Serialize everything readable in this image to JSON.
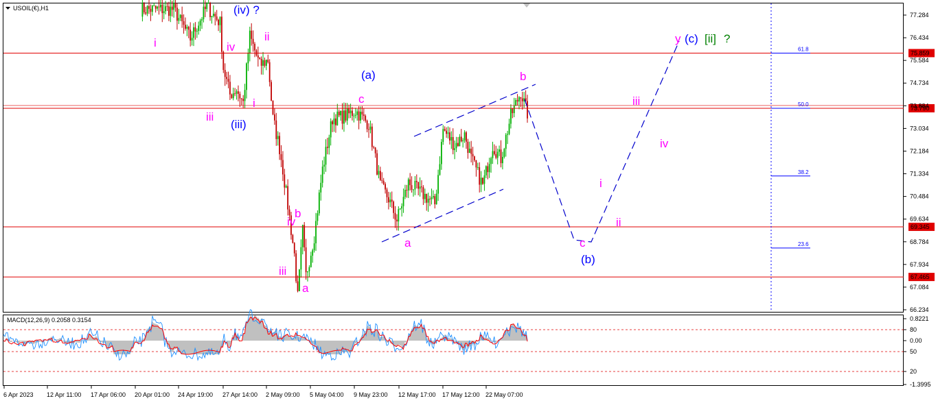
{
  "header": {
    "symbol_label": "USOIL(€),H1"
  },
  "macd": {
    "label": "MACD(12,26,9) 0.2058 0.3154",
    "axis_labels": [
      "0.8221",
      "80",
      "0.00",
      "50",
      "20",
      "-1.3995"
    ]
  },
  "price_axis": {
    "ticks": [
      "77.284",
      "76.434",
      "75.584",
      "74.734",
      "73.884",
      "73.034",
      "72.184",
      "71.334",
      "70.484",
      "69.634",
      "68.784",
      "67.934",
      "67.084",
      "66.234"
    ]
  },
  "price_levels": [
    {
      "label": "75.859",
      "price": 75.859
    },
    {
      "label": "73.790",
      "price": 73.79
    },
    {
      "label": "69.345",
      "price": 69.345
    },
    {
      "label": "67.465",
      "price": 67.465
    }
  ],
  "fib_levels": [
    {
      "label": "61.8",
      "price": 75.859
    },
    {
      "label": "50.0",
      "price": 73.79
    },
    {
      "label": "38.2",
      "price": 71.25
    },
    {
      "label": "23.6",
      "price": 68.55
    }
  ],
  "time_axis": {
    "labels": [
      "6 Apr 2023",
      "12 Apr 11:00",
      "17 Apr 06:00",
      "20 Apr 01:00",
      "24 Apr 19:00",
      "27 Apr 14:00",
      "2 May 09:00",
      "5 May 04:00",
      "9 May 23:00",
      "12 May 17:00",
      "17 May 12:00",
      "22 May 07:00"
    ]
  },
  "wave_labels": [
    {
      "text": "(iv) ?",
      "color": "#0000ff"
    },
    {
      "text": "ii",
      "color": "#ff00ff"
    },
    {
      "text": "iv",
      "color": "#ff00ff"
    },
    {
      "text": "i",
      "color": "#ff00ff"
    },
    {
      "text": "iii",
      "color": "#ff00ff"
    },
    {
      "text": "(iii)",
      "color": "#0000ff"
    },
    {
      "text": "i",
      "color": "#ff00ff"
    },
    {
      "text": "(a)",
      "color": "#0000ff"
    },
    {
      "text": "c",
      "color": "#ff00ff"
    },
    {
      "text": "a",
      "color": "#ff00ff"
    },
    {
      "text": "iv",
      "color": "#ff00ff"
    },
    {
      "text": "iii",
      "color": "#ff00ff"
    },
    {
      "text": "b",
      "color": "#ff00ff"
    },
    {
      "text": "a",
      "color": "#ff00ff"
    },
    {
      "text": "b",
      "color": "#ff00ff"
    },
    {
      "text": "c",
      "color": "#ff00ff"
    },
    {
      "text": "(b)",
      "color": "#0000ff"
    },
    {
      "text": "i",
      "color": "#ff00ff"
    },
    {
      "text": "ii",
      "color": "#ff00ff"
    },
    {
      "text": "iii",
      "color": "#ff00ff"
    },
    {
      "text": "iv",
      "color": "#ff00ff"
    },
    {
      "text": "y",
      "color": "#ff00ff"
    },
    {
      "text": "(c)",
      "color": "#0000ff"
    },
    {
      "text": "[ii]",
      "color": "#008000"
    },
    {
      "text": "?",
      "color": "#008000"
    }
  ],
  "colors": {
    "bull": "#00b000",
    "bear": "#c00000",
    "level": "#e00000",
    "wave_projection": "#0000cc",
    "fib": "#0000ff",
    "macd_hist": "#c0c0c0",
    "macd_signal": "#ff0000",
    "macd_line": "#1e90ff"
  },
  "chart_data": {
    "type": "candlestick",
    "y_range": [
      66.234,
      77.284
    ],
    "path_anchors": [
      {
        "x": 0,
        "y": 77.5
      },
      {
        "x": 20,
        "y": 77.5
      },
      {
        "x": 30,
        "y": 76.4
      },
      {
        "x": 40,
        "y": 77.6
      },
      {
        "x": 48,
        "y": 77.0
      },
      {
        "x": 50,
        "y": 75.3
      },
      {
        "x": 54,
        "y": 74.3
      },
      {
        "x": 58,
        "y": 74.5
      },
      {
        "x": 62,
        "y": 74.0
      },
      {
        "x": 66,
        "y": 76.5
      },
      {
        "x": 72,
        "y": 75.4
      },
      {
        "x": 77,
        "y": 75.6
      },
      {
        "x": 80,
        "y": 73.4
      },
      {
        "x": 84,
        "y": 72.3
      },
      {
        "x": 86,
        "y": 71.5
      },
      {
        "x": 90,
        "y": 69.7
      },
      {
        "x": 93,
        "y": 68.3
      },
      {
        "x": 95,
        "y": 66.7
      },
      {
        "x": 98,
        "y": 69.2
      },
      {
        "x": 100,
        "y": 67.5
      },
      {
        "x": 105,
        "y": 69.0
      },
      {
        "x": 110,
        "y": 71.5
      },
      {
        "x": 116,
        "y": 73.4
      },
      {
        "x": 124,
        "y": 73.5
      },
      {
        "x": 130,
        "y": 73.7
      },
      {
        "x": 138,
        "y": 73.2
      },
      {
        "x": 145,
        "y": 70.9
      },
      {
        "x": 150,
        "y": 70.4
      },
      {
        "x": 155,
        "y": 69.6
      },
      {
        "x": 162,
        "y": 71.0
      },
      {
        "x": 170,
        "y": 70.6
      },
      {
        "x": 178,
        "y": 70.2
      },
      {
        "x": 183,
        "y": 73.0
      },
      {
        "x": 190,
        "y": 72.4
      },
      {
        "x": 196,
        "y": 72.8
      },
      {
        "x": 200,
        "y": 71.9
      },
      {
        "x": 207,
        "y": 70.9
      },
      {
        "x": 213,
        "y": 72.4
      },
      {
        "x": 218,
        "y": 71.9
      },
      {
        "x": 224,
        "y": 73.5
      },
      {
        "x": 230,
        "y": 74.4
      },
      {
        "x": 234,
        "y": 73.6
      }
    ]
  }
}
